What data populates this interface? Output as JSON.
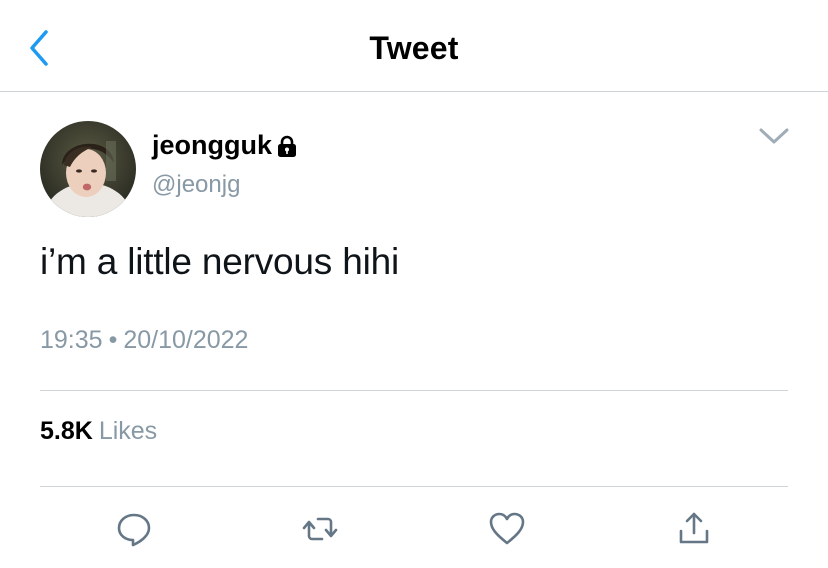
{
  "header": {
    "title": "Tweet"
  },
  "author": {
    "display_name": "jeongguk",
    "handle": "@jeonjg",
    "protected": true
  },
  "tweet": {
    "text": "i’m a little nervous hihi",
    "time": "19:35",
    "separator": "•",
    "date": "20/10/2022"
  },
  "stats": {
    "likes_count": "5.8K",
    "likes_label": "Likes"
  },
  "icons": {
    "back": "chevron-left-icon",
    "lock": "lock-icon",
    "more": "chevron-down-icon",
    "reply": "reply-icon",
    "retweet": "retweet-icon",
    "like": "heart-icon",
    "share": "share-icon"
  },
  "colors": {
    "accent": "#1d9bf0",
    "muted": "#8899a6",
    "divider": "#cfd4d8",
    "icon": "#657786"
  }
}
